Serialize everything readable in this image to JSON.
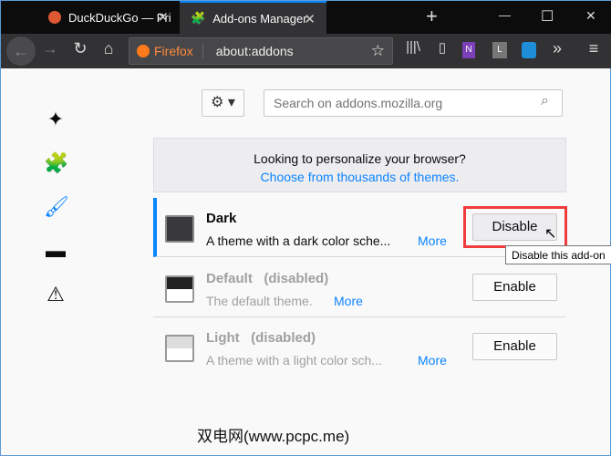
{
  "tabs": [
    {
      "title": "DuckDuckGo — Privacy, sim",
      "icon": "duckduckgo-icon"
    },
    {
      "title": "Add-ons Manager",
      "icon": "puzzle-icon",
      "active": true
    }
  ],
  "window": {
    "minimize": "—",
    "maximize": "☐",
    "close": "✕",
    "new_tab": "+"
  },
  "toolbar": {
    "identity": "Firefox",
    "url": "about:addons"
  },
  "search": {
    "placeholder": "Search on addons.mozilla.org"
  },
  "banner": {
    "text": "Looking to personalize your browser?",
    "link": "Choose from thousands of themes."
  },
  "themes": [
    {
      "name": "Dark",
      "status": "",
      "desc": "A theme with a dark color sche...",
      "more": "More",
      "button": "Disable"
    },
    {
      "name": "Default",
      "status": "(disabled)",
      "desc": "The default theme.",
      "more": "More",
      "button": "Enable"
    },
    {
      "name": "Light",
      "status": "(disabled)",
      "desc": "A theme with a light color sch...",
      "more": "More",
      "button": "Enable"
    }
  ],
  "tooltip": "Disable this add-on",
  "watermark": "双电网(www.pcpc.me)",
  "colors": {
    "accent": "#0a84ff",
    "highlight": "#f03c3c"
  }
}
